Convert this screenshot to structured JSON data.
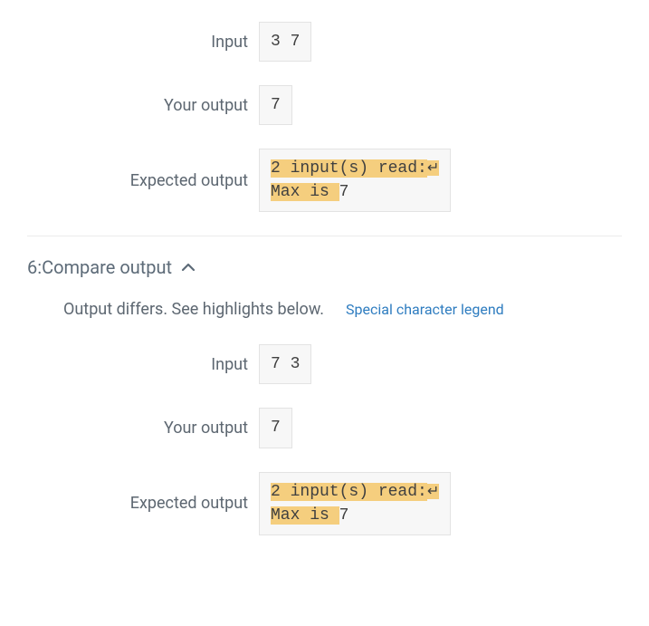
{
  "labels": {
    "input": "Input",
    "your_output": "Your output",
    "expected": "Expected output"
  },
  "newline_glyph": "↵",
  "block1": {
    "input": "3 7",
    "your_output": "7",
    "expected_line1_hl": "2 input(s) read:",
    "expected_line2_hl": "Max is ",
    "expected_line2_tail": "7"
  },
  "section": {
    "title": "6:Compare output",
    "message": "Output differs. See highlights below.",
    "legend_link": "Special character legend"
  },
  "block2": {
    "input": "7 3",
    "your_output": "7",
    "expected_line1_hl": "2 input(s) read:",
    "expected_line2_hl": "Max is ",
    "expected_line2_tail": "7"
  }
}
